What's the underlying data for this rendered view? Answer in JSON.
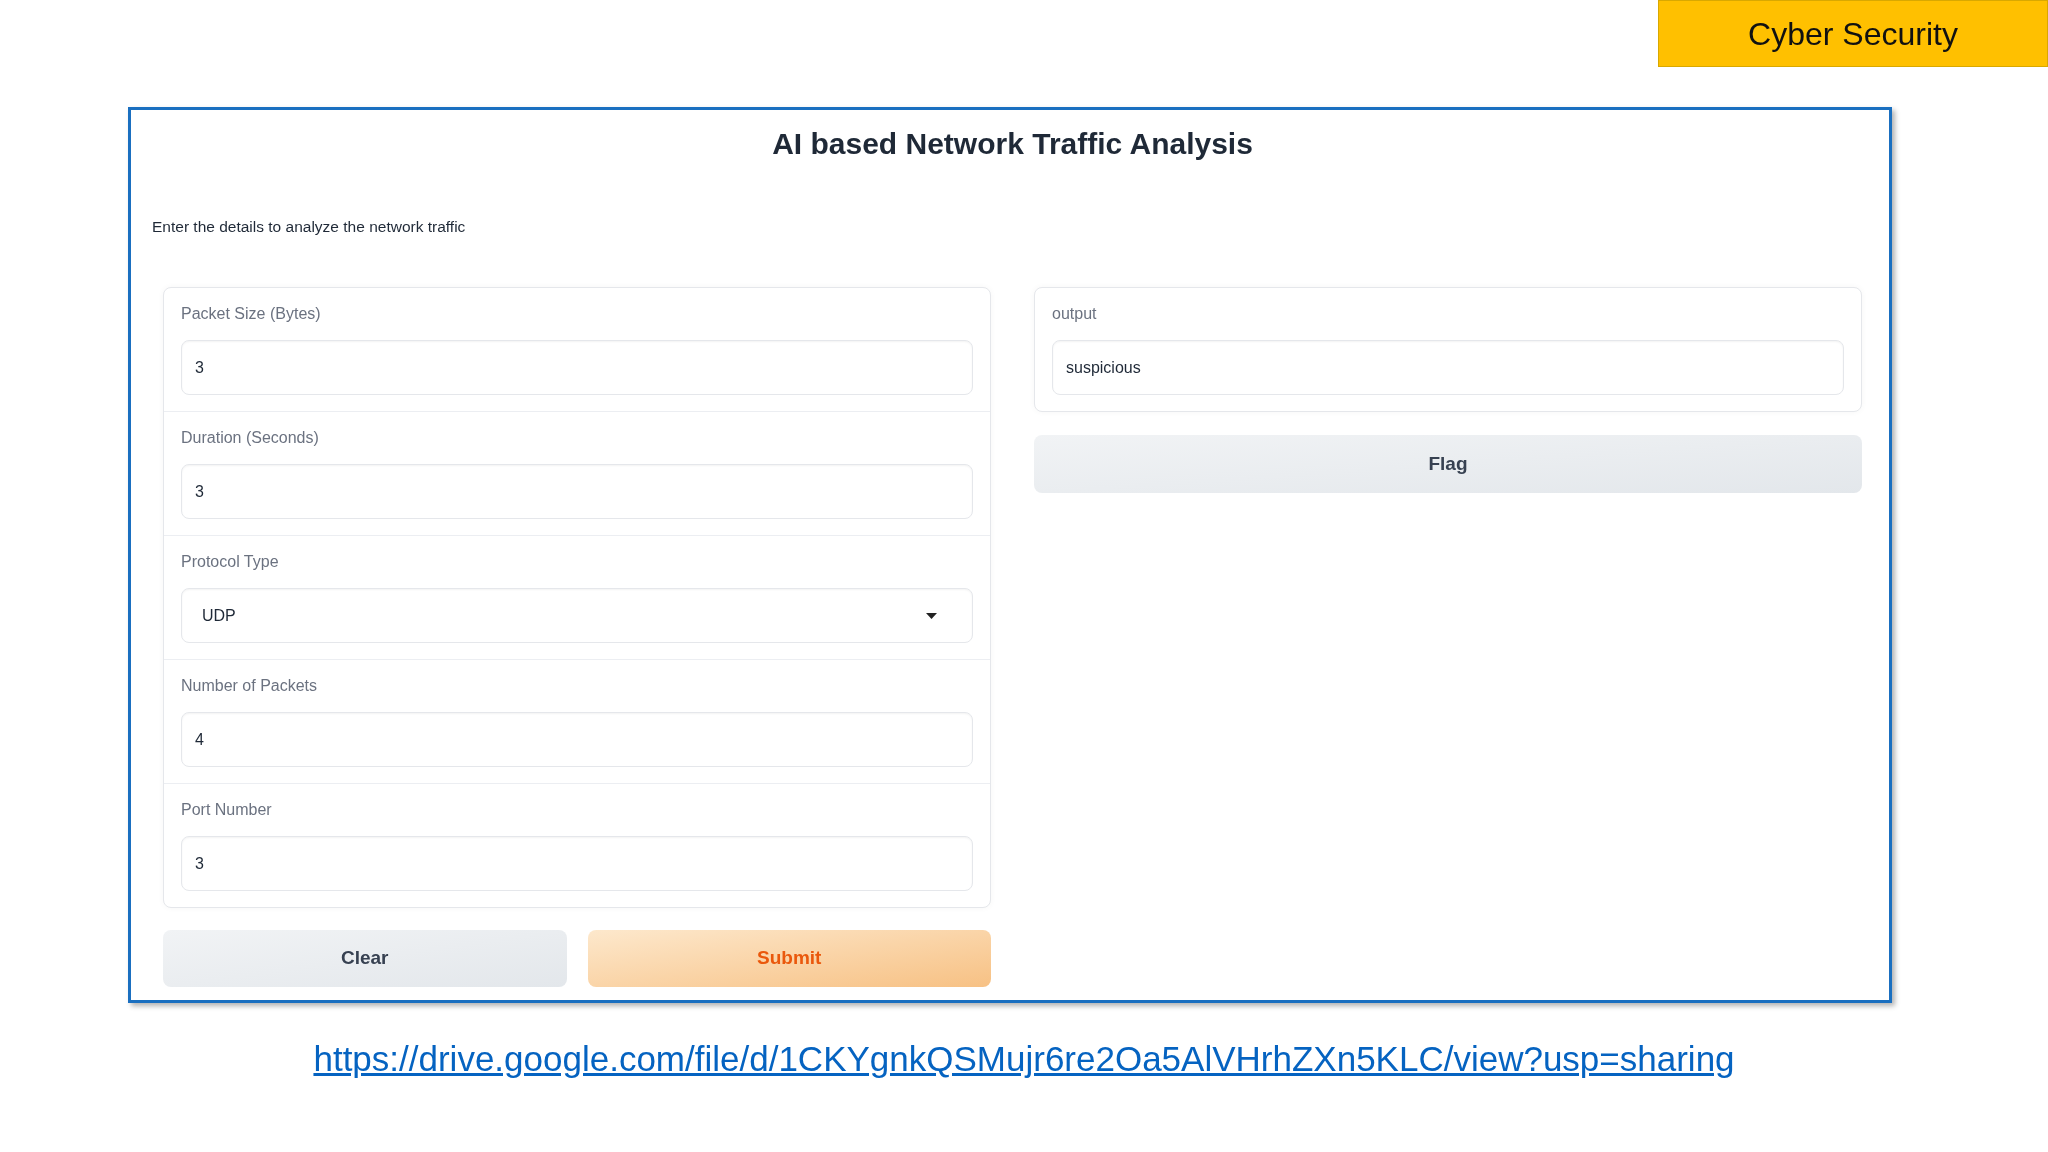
{
  "corner_label": "Cyber Security",
  "app": {
    "title": "AI based Network Traffic Analysis",
    "description": "Enter the details to analyze the network traffic",
    "inputs": [
      {
        "kind": "textbox",
        "label": "Packet Size (Bytes)",
        "value": "3"
      },
      {
        "kind": "textbox",
        "label": "Duration (Seconds)",
        "value": "3"
      },
      {
        "kind": "dropdown",
        "label": "Protocol Type",
        "value": "UDP"
      },
      {
        "kind": "textbox",
        "label": "Number of Packets",
        "value": "4"
      },
      {
        "kind": "textbox",
        "label": "Port Number",
        "value": "3"
      }
    ],
    "input_buttons": [
      {
        "label": "Clear",
        "kind": "secondary"
      },
      {
        "label": "Submit",
        "kind": "primary"
      }
    ],
    "outputs": [
      {
        "kind": "textbox",
        "label": "output",
        "value": "suspicious"
      }
    ],
    "output_buttons": [
      {
        "label": "Flag",
        "kind": "secondary"
      }
    ]
  },
  "link": "https://drive.google.com/file/d/1CKYgnkQSMujr6re2Oa5AlVHrhZXn5KLC/view?usp=sharing"
}
